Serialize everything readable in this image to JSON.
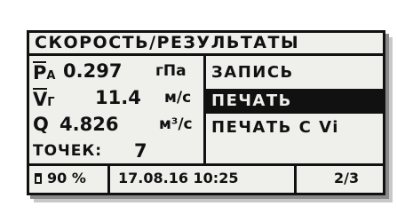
{
  "screen": {
    "title": "СКОРОСТЬ/РЕЗУЛЬТАТЫ"
  },
  "measurements": [
    {
      "symbol": "P",
      "subscript": "A",
      "value": "0.297",
      "unit": "гПа"
    },
    {
      "symbol": "V",
      "subscript": "Г",
      "value": "11.4",
      "unit": "м/с"
    },
    {
      "symbol": "Q",
      "subscript": "",
      "value": "4.826",
      "unit": "м³/с"
    },
    {
      "symbol": "ТОЧЕК:",
      "subscript": "",
      "value": "7",
      "unit": ""
    }
  ],
  "menu": {
    "items": [
      {
        "label": "ЗАПИСЬ",
        "selected": false
      },
      {
        "label": "ПЕЧАТЬ",
        "selected": true
      },
      {
        "label": "ПЕЧАТЬ С Vi",
        "selected": false
      }
    ]
  },
  "status": {
    "battery": "90 %",
    "datetime": "17.08.16 10:25",
    "page": "2/3"
  }
}
